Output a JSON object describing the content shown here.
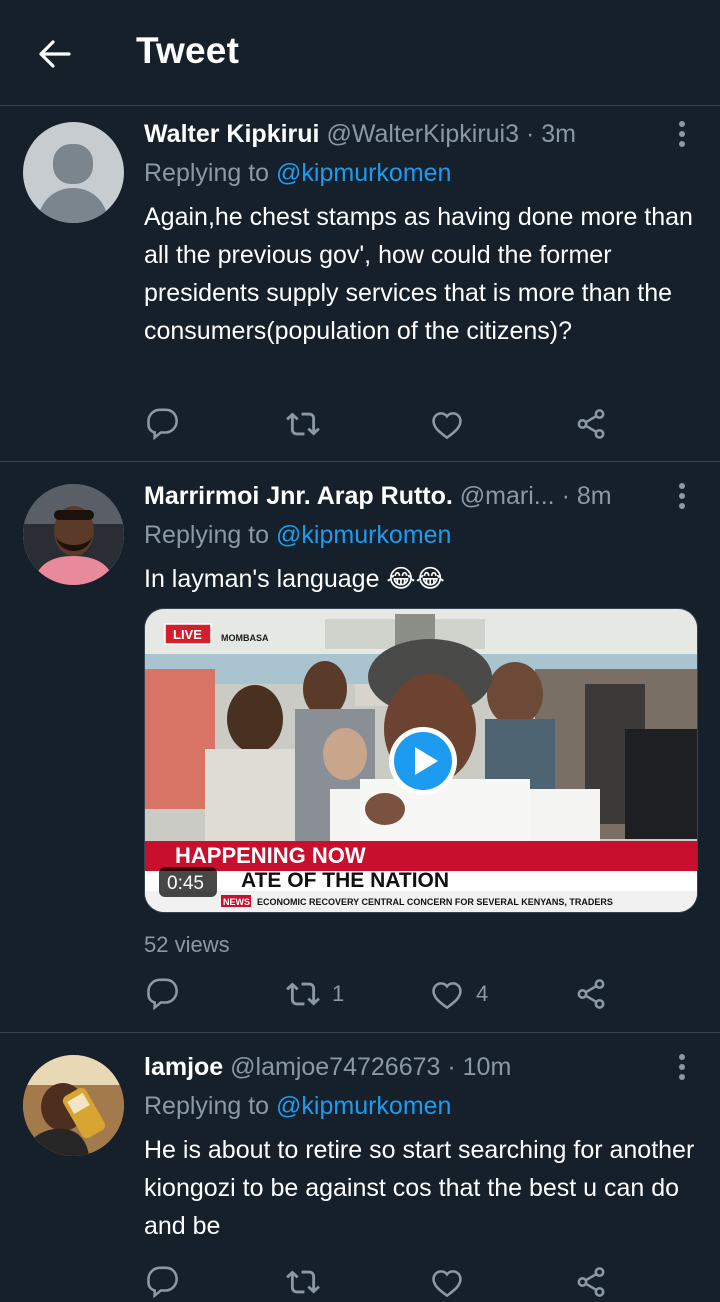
{
  "header": {
    "title": "Tweet"
  },
  "tweets": [
    {
      "name": "Walter Kipkirui",
      "handle": "@WalterKipkirui3",
      "time": "· 3m",
      "replying_prefix": "Replying to",
      "replying_to": "@kipmurkomen",
      "text": "Again,he chest stamps as having done more than all the previous gov', how could the former presidents supply services that is more than the consumers(population of the citizens)?",
      "retweets": "",
      "likes": ""
    },
    {
      "name": "Marrirmoi Jnr. Arap Rutto.",
      "handle": "@mari...",
      "time": "· 8m",
      "replying_prefix": "Replying to",
      "replying_to": "@kipmurkomen",
      "text": "In layman's language 😂😂",
      "video": {
        "duration": "0:45",
        "live_badge": "LIVE",
        "location": "MOMBASA",
        "banner": "HAPPENING NOW",
        "headline": "ATE OF THE NATION",
        "ticker_label": "NEWS",
        "ticker": "ECONOMIC RECOVERY CENTRAL CONCERN FOR SEVERAL KENYANS, TRADERS"
      },
      "views": "52 views",
      "retweets": "1",
      "likes": "4"
    },
    {
      "name": "lamjoe",
      "handle": "@lamjoe74726673",
      "time": "· 10m",
      "replying_prefix": "Replying to",
      "replying_to": "@kipmurkomen",
      "text": "He is about to retire so start searching for another kiongozi to be against cos that the best u can do and be",
      "retweets": "",
      "likes": ""
    }
  ],
  "colors": {
    "background": "#15202b",
    "accent": "#1d9bf0",
    "muted": "#8b98a5",
    "divider": "#38444d"
  }
}
